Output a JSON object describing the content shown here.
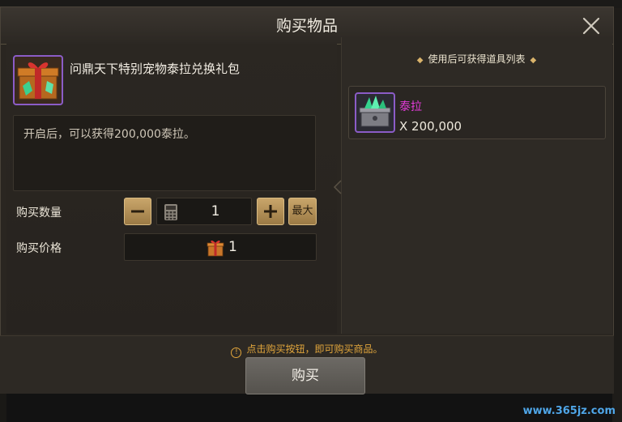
{
  "dialog": {
    "title": "购买物品",
    "close_icon": "close-x-icon"
  },
  "item": {
    "name": "问鼎天下特别宠物泰拉兑换礼包",
    "icon": "gift-box-icon",
    "description": "开启后，可以获得200,000泰拉。"
  },
  "purchase": {
    "quantity_label": "购买数量",
    "quantity_value": "1",
    "max_label": "最大",
    "price_label": "购买价格",
    "price_value": "1",
    "price_currency_icon": "gift-box-icon"
  },
  "rewards": {
    "header": "使用后可获得道具列表",
    "items": [
      {
        "name": "泰拉",
        "quantity": "X 200,000",
        "icon": "crystal-chest-icon"
      }
    ]
  },
  "footer": {
    "hint": "点击购买按钮，即可购买商品。",
    "buy_label": "购买"
  },
  "watermark": "www.365jz.com",
  "colors": {
    "accent_gold": "#c9a56a",
    "rare_purple": "#8b5cc7",
    "item_name_magenta": "#e23bd8",
    "hint_orange": "#e2a63c"
  }
}
